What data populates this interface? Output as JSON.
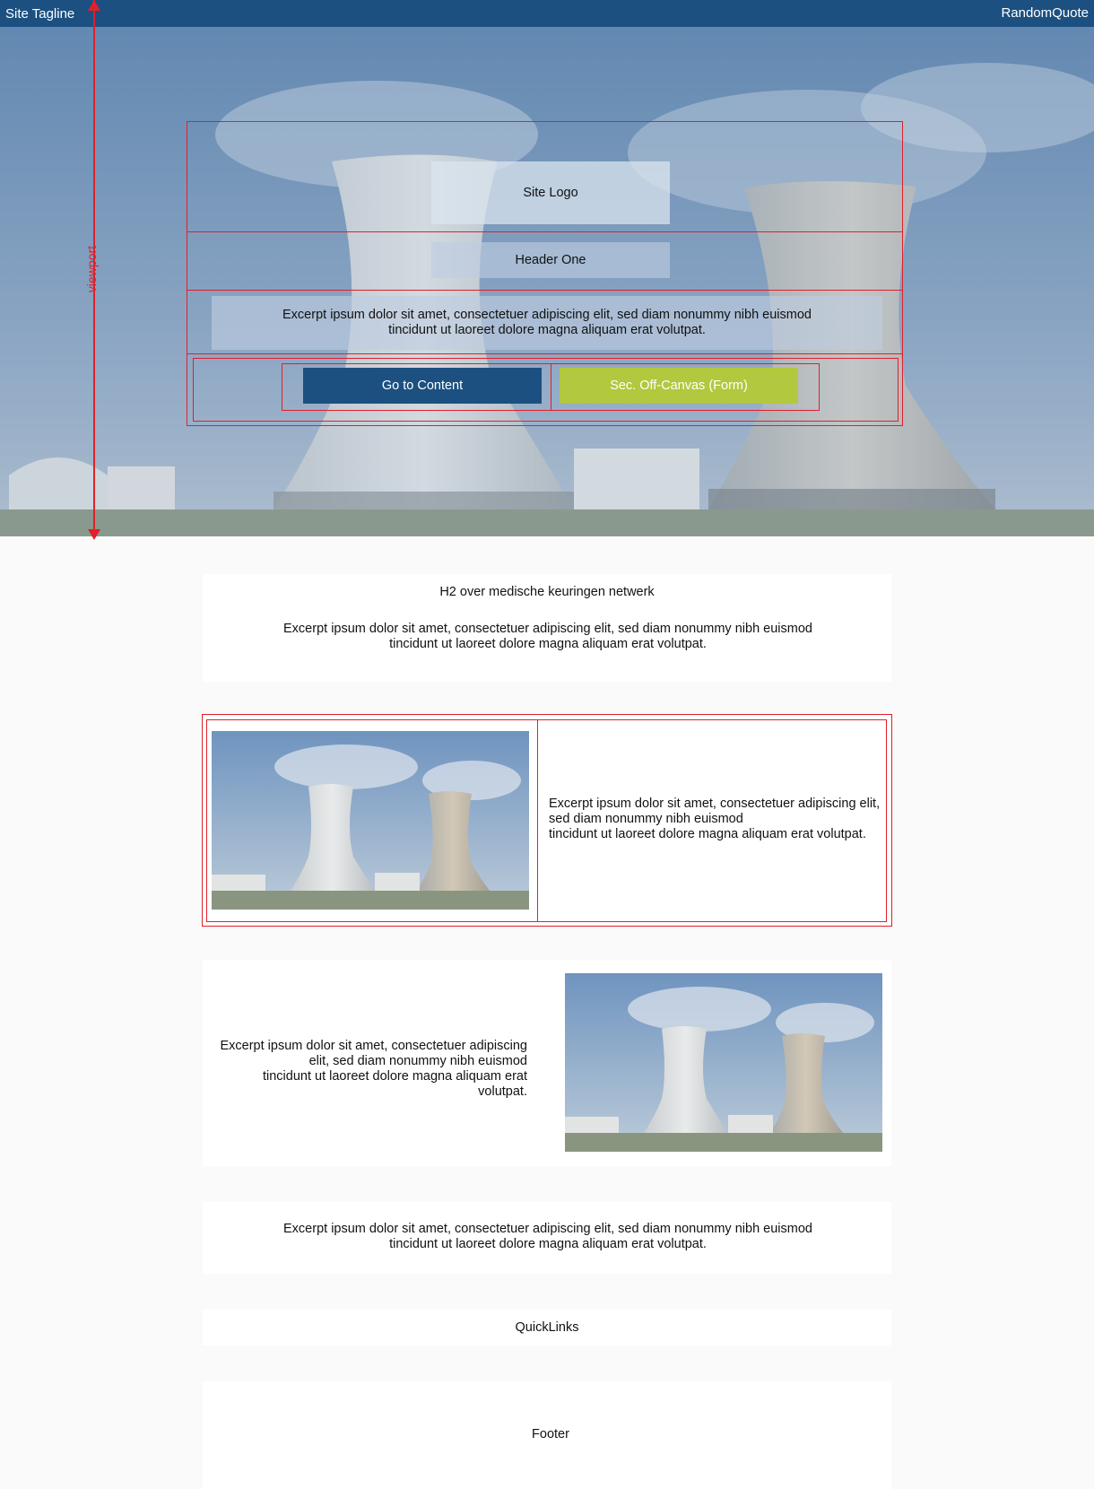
{
  "topbar": {
    "tagline": "Site Tagline",
    "quote": "RandomQuote"
  },
  "annotation": {
    "viewport_label": "viewport"
  },
  "hero": {
    "logo": "Site Logo",
    "header": "Header One",
    "excerpt": "Excerpt ipsum dolor sit amet, consectetuer adipiscing elit, sed diam nonummy nibh euismod tincidunt ut laoreet dolore magna aliquam erat volutpat.",
    "primary_button": "Go to Content",
    "secondary_button": "Sec. Off-Canvas (Form)"
  },
  "intro": {
    "heading": "H2 over medische keuringen netwerk",
    "excerpt": "Excerpt ipsum dolor sit amet, consectetuer adipiscing elit, sed diam nonummy nibh euismod tincidunt ut laoreet dolore magna aliquam erat volutpat."
  },
  "feature_left": {
    "excerpt_line1": "Excerpt ipsum dolor sit amet, consectetuer adipiscing elit, sed diam nonummy nibh euismod",
    "excerpt_line2": "tincidunt ut laoreet dolore magna aliquam erat volutpat."
  },
  "feature_right": {
    "excerpt_line1": "Excerpt ipsum dolor sit amet, consectetuer adipiscing elit, sed diam nonummy nibh euismod",
    "excerpt_line2": "tincidunt ut laoreet dolore magna aliquam erat volutpat."
  },
  "text_block": {
    "excerpt": "Excerpt ipsum dolor sit amet, consectetuer adipiscing elit, sed diam nonummy nibh euismod tincidunt ut laoreet dolore magna aliquam erat volutpat."
  },
  "quicklinks": {
    "label": "QuickLinks"
  },
  "footer": {
    "label": "Footer"
  },
  "colors": {
    "brand": "#1c5080",
    "accent": "#b2c83e",
    "annotation": "#e0202a",
    "background": "#fafafa"
  }
}
